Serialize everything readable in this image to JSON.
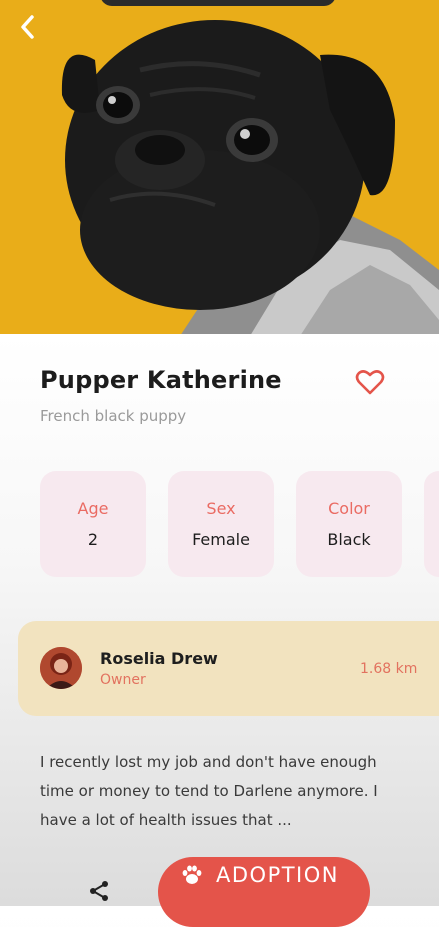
{
  "pet": {
    "name": "Pupper Katherine",
    "description": "French black puppy"
  },
  "attributes": [
    {
      "label": "Age",
      "value": "2"
    },
    {
      "label": "Sex",
      "value": "Female"
    },
    {
      "label": "Color",
      "value": "Black"
    }
  ],
  "owner": {
    "name": "Roselia Drew",
    "role": "Owner",
    "distance": "1.68 km"
  },
  "story": "I recently lost my job and don't have enough time or money to tend to Darlene anymore. I have a lot of health issues that ...",
  "actions": {
    "adopt_label": "ADOPTION"
  },
  "icons": {
    "back": "chevron-left-icon",
    "favorite": "heart-outline-icon",
    "share": "share-icon",
    "paw": "paw-icon"
  },
  "colors": {
    "hero_background": "#e9ad19",
    "accent": "#e4544a",
    "accent_text": "#ea6b63",
    "attribute_card": "#f7e9ef",
    "owner_card": "#f2e3bf"
  }
}
